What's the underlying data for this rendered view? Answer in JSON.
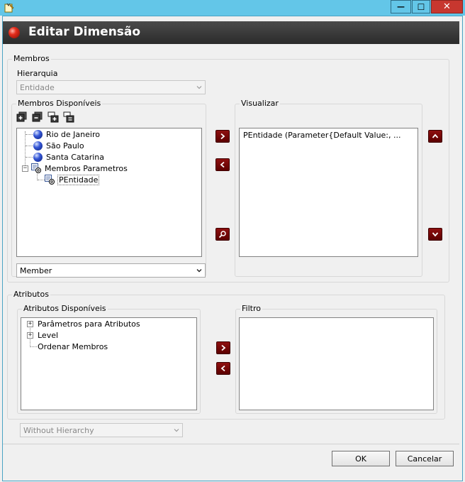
{
  "window": {
    "minimize_glyph": "—",
    "maximize_glyph": "☐",
    "close_glyph": "✕"
  },
  "dialog": {
    "title": "Editar Dimensão"
  },
  "membros": {
    "group_label": "Membros",
    "hierarquia_label": "Hierarquia",
    "hierarquia_value": "Entidade",
    "disponiveis_label": "Membros Disponíveis",
    "toolbar_icons": [
      "expand-all-icon",
      "collapse-all-icon",
      "add-node-icon",
      "tree-settings-icon"
    ],
    "tree": [
      {
        "label": "Rio de Janeiro",
        "icon": "blue-ball-icon",
        "level": 0
      },
      {
        "label": "São Paulo",
        "icon": "blue-ball-icon",
        "level": 0
      },
      {
        "label": "Santa Catarina",
        "icon": "blue-ball-icon",
        "level": 0
      },
      {
        "label": "Membros Parametros",
        "icon": "parameter-icon",
        "level": 0,
        "expanded": true
      },
      {
        "label": "PEntidade",
        "icon": "parameter-icon",
        "level": 1
      }
    ],
    "member_type_value": "Member",
    "visualizar_label": "Visualizar",
    "visualizar_items": [
      "PEntidade (Parameter{Default Value:, ..."
    ]
  },
  "atributos": {
    "group_label": "Atributos",
    "disponiveis_label": "Atributos Disponíveis",
    "tree": [
      {
        "label": "Parâmetros para Atributos",
        "expandable": true
      },
      {
        "label": "Level",
        "expandable": true
      },
      {
        "label": "Ordenar Membros",
        "expandable": false
      }
    ],
    "filtro_label": "Filtro"
  },
  "hierarchy_mode_value": "Without Hierarchy",
  "buttons": {
    "ok": "OK",
    "cancel": "Cancelar"
  },
  "colors": {
    "titlebar": "#63c6e8",
    "header_band": "#2b2b2b",
    "action_button": "#7a0a0a"
  }
}
